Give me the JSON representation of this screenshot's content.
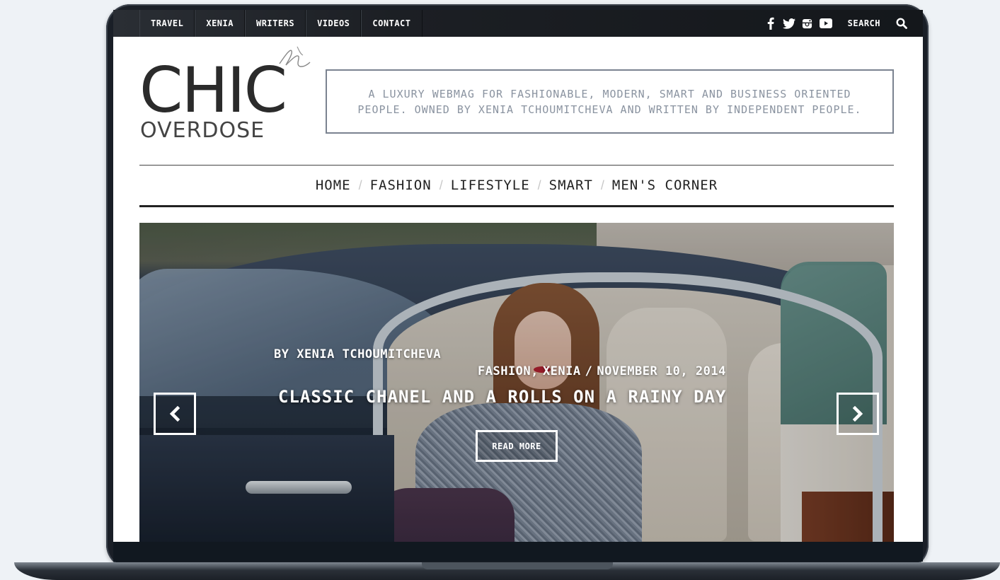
{
  "top_nav": {
    "items": [
      {
        "label": "TRAVEL"
      },
      {
        "label": "XENIA"
      },
      {
        "label": "WRITERS"
      },
      {
        "label": "VIDEOS"
      },
      {
        "label": "CONTACT"
      }
    ],
    "social_icons": [
      "facebook-icon",
      "twitter-icon",
      "instagram-icon",
      "youtube-icon"
    ],
    "search_label": "SEARCH",
    "search_icon": "magnifier-icon"
  },
  "header": {
    "logo_main": "CHIC",
    "logo_sub": "OVERDOSE",
    "tagline_line1": "A LUXURY WEBMAG FOR FASHIONABLE, MODERN, SMART AND BUSINESS ORIENTED",
    "tagline_line2": "PEOPLE. OWNED BY XENIA TCHOUMITCHEVA AND WRITTEN BY INDEPENDENT PEOPLE."
  },
  "main_nav": {
    "items": [
      {
        "label": "HOME"
      },
      {
        "label": "FASHION"
      },
      {
        "label": "LIFESTYLE"
      },
      {
        "label": "SMART"
      },
      {
        "label": "MEN'S CORNER"
      }
    ],
    "separator": "/"
  },
  "slider": {
    "author": "BY XENIA TCHOUMITCHEVA",
    "category_1": "FASHION,",
    "category_2": "XENIA",
    "meta_separator": "/",
    "date": "NOVEMBER 10, 2014",
    "title": "CLASSIC CHANEL AND A ROLLS ON A RAINY DAY",
    "read_more": "READ MORE",
    "prev_icon": "chevron-left-icon",
    "next_icon": "chevron-right-icon"
  },
  "colors": {
    "top_bar": "#1c1f24",
    "tagline_border": "#7b8390",
    "tagline_text": "#8a93a0",
    "laptop_bezel": "#1a1f27",
    "background": "#eef2f6"
  }
}
